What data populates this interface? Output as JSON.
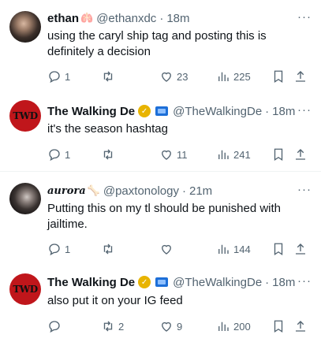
{
  "tweets": [
    {
      "name": "ethan",
      "handle": "@ethanxdc",
      "time": "18m",
      "text": "using the caryl ship tag and posting this is definitely a decision",
      "reply": "1",
      "retweet": "",
      "like": "23",
      "views": "225"
    },
    {
      "name": "The Walking De",
      "handle": "@TheWalkingDe",
      "time": "18m",
      "text": "it's the season hashtag",
      "reply": "1",
      "retweet": "",
      "like": "11",
      "views": "241",
      "avatar_text": "TWD"
    },
    {
      "name": "aurora",
      "handle": "@paxtonology",
      "time": "21m",
      "text": "Putting this on my tl should be punished with jailtime.",
      "reply": "1",
      "retweet": "",
      "like": "",
      "views": "144"
    },
    {
      "name": "The Walking De",
      "handle": "@TheWalkingDe",
      "time": "18m",
      "text": "also put it on your IG feed",
      "reply": "",
      "retweet": "2",
      "like": "9",
      "views": "200",
      "avatar_text": "TWD"
    }
  ],
  "ui": {
    "dot": "·",
    "more": "···"
  },
  "colors": {
    "text": "#0f1419",
    "secondary": "#536471",
    "divider": "#eff3f4",
    "verified_gold": "#e8b400",
    "twd_red": "#c0161b"
  }
}
